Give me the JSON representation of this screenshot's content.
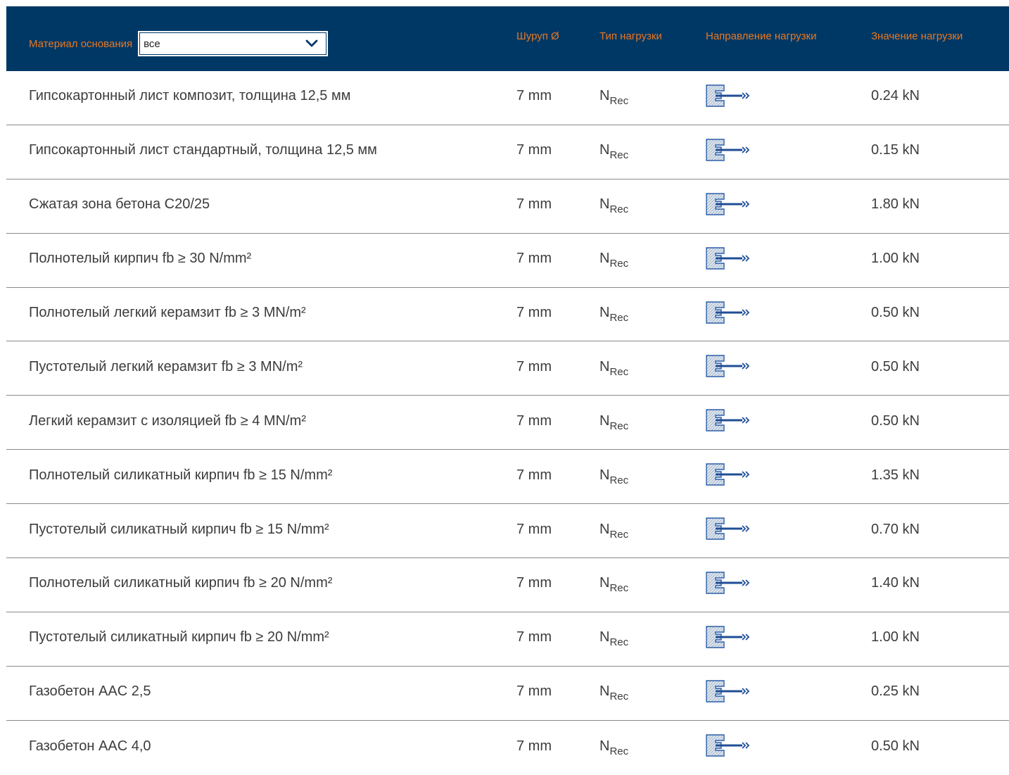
{
  "header": {
    "material_label": "Материал основания",
    "filter_value": "все",
    "screw_label": "Шуруп Ø",
    "load_type_label": "Тип нагрузки",
    "direction_label": "Направление нагрузки",
    "value_label": "Значение нагрузки"
  },
  "colors": {
    "header_bg": "#003865",
    "header_text": "#e87722",
    "icon_blue": "#2b5fa8"
  },
  "icons": {
    "filter_dropdown": "chevron-down-icon",
    "direction": "tension-load-direction-icon"
  },
  "rows": [
    {
      "material": "Гипсокартонный лист композит, толщина 12,5 мм",
      "screw": "7 mm",
      "load_main": "N",
      "load_sub": "Rec",
      "value": "0.24 kN"
    },
    {
      "material": "Гипсокартонный лист стандартный, толщина 12,5 мм",
      "screw": "7 mm",
      "load_main": "N",
      "load_sub": "Rec",
      "value": "0.15 kN"
    },
    {
      "material": "Сжатая зона бетона C20/25",
      "screw": "7 mm",
      "load_main": "N",
      "load_sub": "Rec",
      "value": "1.80 kN"
    },
    {
      "material": "Полнотелый кирпич fb ≥ 30 N/mm²",
      "screw": "7 mm",
      "load_main": "N",
      "load_sub": "Rec",
      "value": "1.00 kN"
    },
    {
      "material": "Полнотелый легкий керамзит fb ≥ 3 MN/m²",
      "screw": "7 mm",
      "load_main": "N",
      "load_sub": "Rec",
      "value": "0.50 kN"
    },
    {
      "material": "Пустотелый легкий керамзит fb ≥ 3 MN/m²",
      "screw": "7 mm",
      "load_main": "N",
      "load_sub": "Rec",
      "value": "0.50 kN"
    },
    {
      "material": "Легкий керамзит с изоляцией fb ≥ 4 MN/m²",
      "screw": "7 mm",
      "load_main": "N",
      "load_sub": "Rec",
      "value": "0.50 kN"
    },
    {
      "material": "Полнотелый силикатный кирпич fb ≥ 15 N/mm²",
      "screw": "7 mm",
      "load_main": "N",
      "load_sub": "Rec",
      "value": "1.35 kN"
    },
    {
      "material": "Пустотелый силикатный кирпич fb ≥ 15 N/mm²",
      "screw": "7 mm",
      "load_main": "N",
      "load_sub": "Rec",
      "value": "0.70 kN"
    },
    {
      "material": "Полнотелый силикатный кирпич fb ≥ 20 N/mm²",
      "screw": "7 mm",
      "load_main": "N",
      "load_sub": "Rec",
      "value": "1.40 kN"
    },
    {
      "material": "Пустотелый силикатный кирпич fb ≥ 20 N/mm²",
      "screw": "7 mm",
      "load_main": "N",
      "load_sub": "Rec",
      "value": "1.00 kN"
    },
    {
      "material": "Газобетон AAC 2,5",
      "screw": "7 mm",
      "load_main": "N",
      "load_sub": "Rec",
      "value": "0.25 kN"
    },
    {
      "material": "Газобетон AAC 4,0",
      "screw": "7 mm",
      "load_main": "N",
      "load_sub": "Rec",
      "value": "0.50 kN"
    }
  ]
}
